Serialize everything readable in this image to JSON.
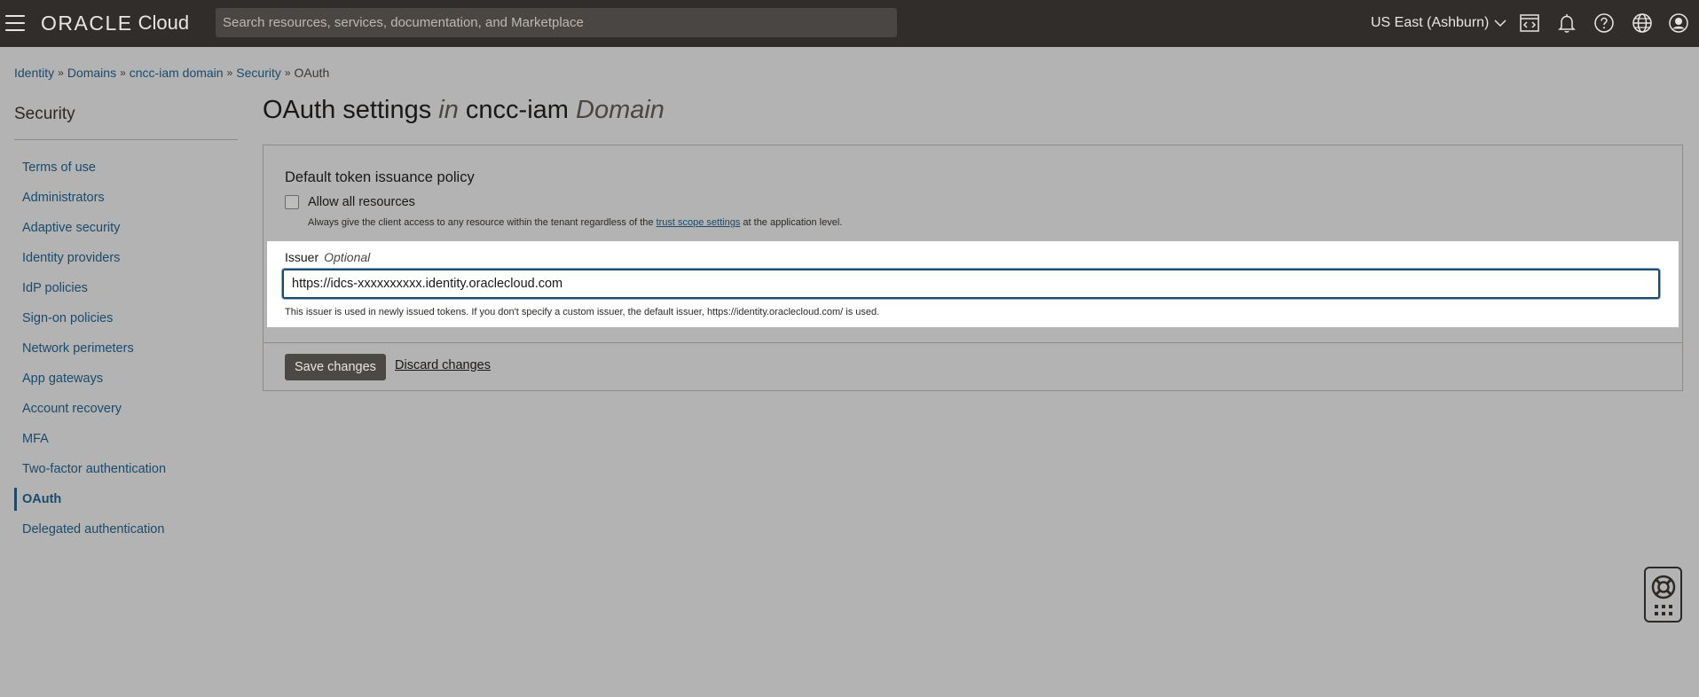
{
  "topbar": {
    "brand_oracle": "ORACLE",
    "brand_cloud": "Cloud",
    "search_placeholder": "Search resources, services, documentation, and Marketplace",
    "region": "US East (Ashburn)",
    "icons": [
      "menu-icon",
      "chevron-down-icon",
      "code-editor-icon",
      "bell-icon",
      "help-icon",
      "globe-icon",
      "user-icon"
    ]
  },
  "breadcrumb": {
    "items": [
      "Identity",
      "Domains",
      "cncc-iam domain",
      "Security"
    ],
    "current": "OAuth",
    "separator": "»"
  },
  "sidebar": {
    "title": "Security",
    "items": [
      {
        "label": "Terms of use"
      },
      {
        "label": "Administrators"
      },
      {
        "label": "Adaptive security"
      },
      {
        "label": "Identity providers"
      },
      {
        "label": "IdP policies"
      },
      {
        "label": "Sign-on policies"
      },
      {
        "label": "Network perimeters"
      },
      {
        "label": "App gateways"
      },
      {
        "label": "Account recovery"
      },
      {
        "label": "MFA"
      },
      {
        "label": "Two-factor authentication"
      },
      {
        "label": "OAuth",
        "active": true
      },
      {
        "label": "Delegated authentication"
      }
    ]
  },
  "main": {
    "title_part1": "OAuth settings",
    "title_in": "in",
    "title_domain_name": "cncc-iam",
    "title_domain": "Domain",
    "section_title": "Default token issuance policy",
    "checkbox_label": "Allow all resources",
    "checkbox_checked": false,
    "checkbox_help_pre": "Always give the client access to any resource within the tenant regardless of the",
    "checkbox_help_link": "trust scope settings",
    "checkbox_help_post": "at the application level.",
    "issuer_label": "Issuer",
    "issuer_optional": "Optional",
    "issuer_value": "https://idcs-xxxxxxxxxx.identity.oraclecloud.com",
    "issuer_help": "This issuer is used in newly issued tokens. If you don't specify a custom issuer, the default issuer, https://identity.oraclecloud.com/ is used.",
    "save_label": "Save changes",
    "discard_label": "Discard changes"
  },
  "colors": {
    "topbar_bg": "#312d2a",
    "link": "#1b4a6b",
    "page_bg": "#b3b3b3",
    "button_bg": "#4c4844"
  }
}
